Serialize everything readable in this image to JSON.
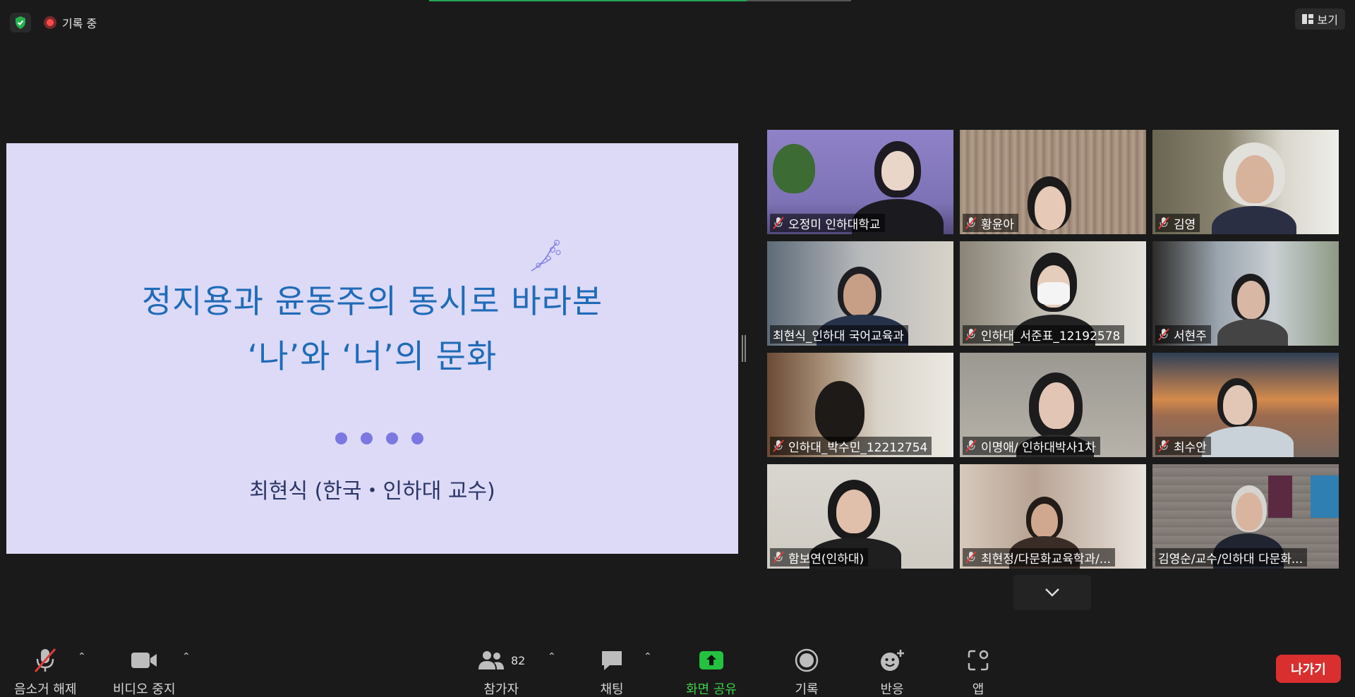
{
  "top": {
    "recording_label": "기록 중",
    "view_label": "보기"
  },
  "slide": {
    "title_line1": "정지용과 윤동주의 동시로 바라본",
    "title_line2": "‘나’와 ‘너’의 문화",
    "author": "최현식 (한국・인하대 교수)"
  },
  "participants": [
    {
      "name": "오정미 인하대학교",
      "muted": true
    },
    {
      "name": "황윤아",
      "muted": true
    },
    {
      "name": "김영",
      "muted": true
    },
    {
      "name": "최현식_인하대 국어교육과",
      "muted": false,
      "active": true
    },
    {
      "name": "인하대_서준표_12192578",
      "muted": true
    },
    {
      "name": "서현주",
      "muted": true
    },
    {
      "name": "인하대_박수민_12212754",
      "muted": true
    },
    {
      "name": "이명애/ 인하대박사1차",
      "muted": true
    },
    {
      "name": "최수안",
      "muted": true
    },
    {
      "name": "함보연(인하대)",
      "muted": true
    },
    {
      "name": "최현정/다문화교육학과/...",
      "muted": true
    },
    {
      "name": "김영순/교수/인하대 다문화...",
      "muted": false
    }
  ],
  "toolbar": {
    "unmute_label": "음소거 해제",
    "video_label": "비디오 중지",
    "participants_label": "참가자",
    "participants_count": "82",
    "chat_label": "채팅",
    "share_label": "화면 공유",
    "record_label": "기록",
    "reactions_label": "반응",
    "apps_label": "앱",
    "leave_label": "나가기"
  },
  "colors": {
    "share_green": "#3ecf4a",
    "leave_red": "#d92f2f",
    "active_speaker": "#d7ec5b",
    "slide_bg": "#dcdaf7",
    "slide_title": "#1f6bb8"
  }
}
